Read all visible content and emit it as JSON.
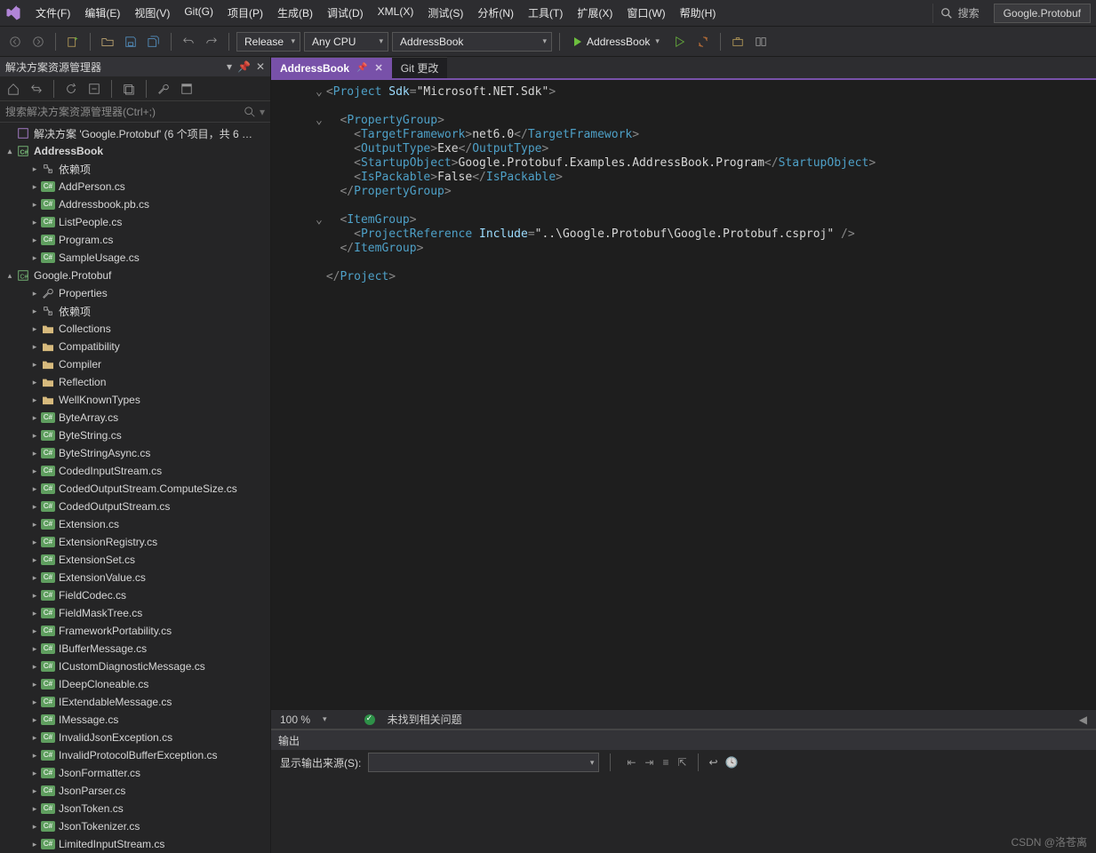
{
  "menubar": {
    "items": [
      "文件(F)",
      "编辑(E)",
      "视图(V)",
      "Git(G)",
      "项目(P)",
      "生成(B)",
      "调试(D)",
      "XML(X)",
      "测试(S)",
      "分析(N)",
      "工具(T)",
      "扩展(X)",
      "窗口(W)",
      "帮助(H)"
    ],
    "search_label": "搜索",
    "crumb": "Google.Protobuf"
  },
  "toolbar": {
    "config": "Release",
    "platform": "Any CPU",
    "startup_project": "AddressBook",
    "run_label": "AddressBook"
  },
  "panel": {
    "title": "解决方案资源管理器",
    "search_placeholder": "搜索解决方案资源管理器(Ctrl+;)"
  },
  "tree": {
    "solution": "解决方案 'Google.Protobuf' (6 个项目，共 6 …",
    "projects": [
      {
        "name": "AddressBook",
        "bold": true,
        "children": [
          {
            "icon": "ref",
            "label": "依赖项"
          },
          {
            "icon": "cs",
            "label": "AddPerson.cs"
          },
          {
            "icon": "cs",
            "label": "Addressbook.pb.cs"
          },
          {
            "icon": "cs",
            "label": "ListPeople.cs"
          },
          {
            "icon": "cs",
            "label": "Program.cs"
          },
          {
            "icon": "cs",
            "label": "SampleUsage.cs"
          }
        ]
      },
      {
        "name": "Google.Protobuf",
        "bold": false,
        "children": [
          {
            "icon": "prop",
            "label": "Properties"
          },
          {
            "icon": "ref",
            "label": "依赖项"
          },
          {
            "icon": "folder",
            "label": "Collections"
          },
          {
            "icon": "folder",
            "label": "Compatibility"
          },
          {
            "icon": "folder",
            "label": "Compiler"
          },
          {
            "icon": "folder",
            "label": "Reflection"
          },
          {
            "icon": "folder",
            "label": "WellKnownTypes"
          },
          {
            "icon": "cs",
            "label": "ByteArray.cs"
          },
          {
            "icon": "cs",
            "label": "ByteString.cs"
          },
          {
            "icon": "cs",
            "label": "ByteStringAsync.cs"
          },
          {
            "icon": "cs",
            "label": "CodedInputStream.cs"
          },
          {
            "icon": "cs",
            "label": "CodedOutputStream.ComputeSize.cs"
          },
          {
            "icon": "cs",
            "label": "CodedOutputStream.cs"
          },
          {
            "icon": "cs",
            "label": "Extension.cs"
          },
          {
            "icon": "cs",
            "label": "ExtensionRegistry.cs"
          },
          {
            "icon": "cs",
            "label": "ExtensionSet.cs"
          },
          {
            "icon": "cs",
            "label": "ExtensionValue.cs"
          },
          {
            "icon": "cs",
            "label": "FieldCodec.cs"
          },
          {
            "icon": "cs",
            "label": "FieldMaskTree.cs"
          },
          {
            "icon": "cs",
            "label": "FrameworkPortability.cs"
          },
          {
            "icon": "cs",
            "label": "IBufferMessage.cs"
          },
          {
            "icon": "cs",
            "label": "ICustomDiagnosticMessage.cs"
          },
          {
            "icon": "cs",
            "label": "IDeepCloneable.cs"
          },
          {
            "icon": "cs",
            "label": "IExtendableMessage.cs"
          },
          {
            "icon": "cs",
            "label": "IMessage.cs"
          },
          {
            "icon": "cs",
            "label": "InvalidJsonException.cs"
          },
          {
            "icon": "cs",
            "label": "InvalidProtocolBufferException.cs"
          },
          {
            "icon": "cs",
            "label": "JsonFormatter.cs"
          },
          {
            "icon": "cs",
            "label": "JsonParser.cs"
          },
          {
            "icon": "cs",
            "label": "JsonToken.cs"
          },
          {
            "icon": "cs",
            "label": "JsonTokenizer.cs"
          },
          {
            "icon": "cs",
            "label": "LimitedInputStream.cs"
          }
        ]
      }
    ]
  },
  "tabs": {
    "active": "AddressBook",
    "inactive": "Git 更改"
  },
  "code": {
    "lines": [
      {
        "g": "⌄",
        "html": "<span class='c-punc'>&lt;</span><span class='c-tag'>Project</span> <span class='c-attr'>Sdk</span><span class='c-punc'>=</span><span class='c-str'>\"Microsoft.NET.Sdk\"</span><span class='c-punc'>&gt;</span>"
      },
      {
        "g": "",
        "html": ""
      },
      {
        "g": "⌄",
        "html": "  <span class='c-punc'>&lt;</span><span class='c-tag'>PropertyGroup</span><span class='c-punc'>&gt;</span>"
      },
      {
        "g": "",
        "html": "    <span class='c-punc'>&lt;</span><span class='c-tag'>TargetFramework</span><span class='c-punc'>&gt;</span>net6.0<span class='c-punc'>&lt;/</span><span class='c-tag'>TargetFramework</span><span class='c-punc'>&gt;</span>"
      },
      {
        "g": "",
        "html": "    <span class='c-punc'>&lt;</span><span class='c-tag'>OutputType</span><span class='c-punc'>&gt;</span>Exe<span class='c-punc'>&lt;/</span><span class='c-tag'>OutputType</span><span class='c-punc'>&gt;</span>"
      },
      {
        "g": "",
        "html": "    <span class='c-punc'>&lt;</span><span class='c-tag'>StartupObject</span><span class='c-punc'>&gt;</span>Google.Protobuf.Examples.AddressBook.Program<span class='c-punc'>&lt;/</span><span class='c-tag'>StartupObject</span><span class='c-punc'>&gt;</span>"
      },
      {
        "g": "",
        "html": "    <span class='c-punc'>&lt;</span><span class='c-tag'>IsPackable</span><span class='c-punc'>&gt;</span>False<span class='c-punc'>&lt;/</span><span class='c-tag'>IsPackable</span><span class='c-punc'>&gt;</span>"
      },
      {
        "g": "",
        "html": "  <span class='c-punc'>&lt;/</span><span class='c-tag'>PropertyGroup</span><span class='c-punc'>&gt;</span>"
      },
      {
        "g": "",
        "html": ""
      },
      {
        "g": "⌄",
        "html": "  <span class='c-punc'>&lt;</span><span class='c-tag'>ItemGroup</span><span class='c-punc'>&gt;</span>"
      },
      {
        "g": "",
        "html": "    <span class='c-punc'>&lt;</span><span class='c-tag'>ProjectReference</span> <span class='c-attr'>Include</span><span class='c-punc'>=</span><span class='c-str'>\"..\\Google.Protobuf\\Google.Protobuf.csproj\"</span> <span class='c-punc'>/&gt;</span>"
      },
      {
        "g": "",
        "html": "  <span class='c-punc'>&lt;/</span><span class='c-tag'>ItemGroup</span><span class='c-punc'>&gt;</span>"
      },
      {
        "g": "",
        "html": ""
      },
      {
        "g": "",
        "html": "<span class='c-punc'>&lt;/</span><span class='c-tag'>Project</span><span class='c-punc'>&gt;</span>"
      }
    ]
  },
  "status": {
    "zoom": "100 %",
    "issues": "未找到相关问题"
  },
  "output": {
    "title": "输出",
    "source_label": "显示输出来源(S):"
  },
  "watermark": "CSDN @洛苍离"
}
